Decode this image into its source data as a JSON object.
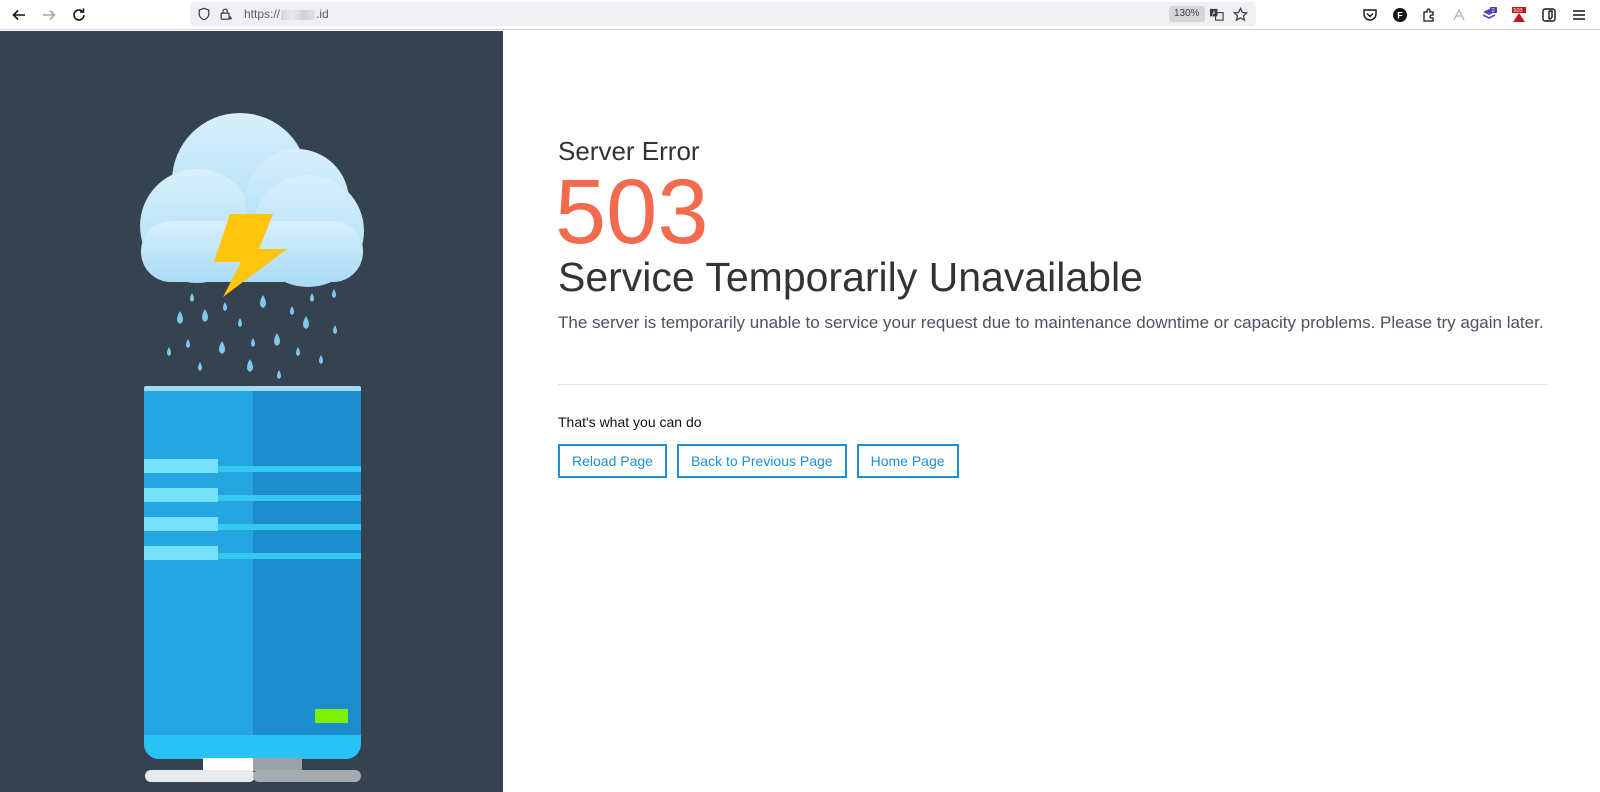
{
  "browser": {
    "url_prefix": "https://",
    "url_suffix": ".id",
    "zoom": "130%",
    "extensions": {
      "badge_count_a": "2",
      "badge_code_b": "503"
    }
  },
  "error": {
    "kind": "Server Error",
    "code": "503",
    "title": "Service Temporarily Unavailable",
    "description": "The server is temporarily unable to service your request due to maintenance downtime or capacity problems. Please try again later."
  },
  "actions": {
    "label": "That's what you can do",
    "reload": "Reload Page",
    "back": "Back to Previous Page",
    "home": "Home Page"
  },
  "colors": {
    "panel": "#36424f",
    "accent": "#1e8fd6",
    "code": "#f26b4f"
  }
}
